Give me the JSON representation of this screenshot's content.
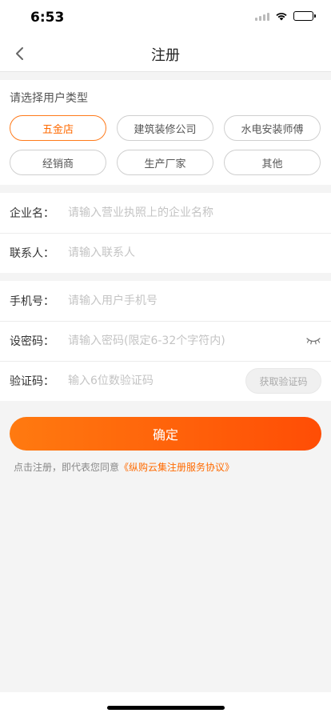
{
  "status_bar": {
    "time": "6:53"
  },
  "nav": {
    "title": "注册"
  },
  "user_type": {
    "label": "请选择用户类型",
    "options": [
      "五金店",
      "建筑装修公司",
      "水电安装师傅",
      "经销商",
      "生产厂家",
      "其他"
    ],
    "selected_index": 0
  },
  "company_form": {
    "company_label": "企业名：",
    "company_placeholder": "请输入营业执照上的企业名称",
    "contact_label": "联系人：",
    "contact_placeholder": "请输入联系人"
  },
  "account_form": {
    "phone_label": "手机号：",
    "phone_placeholder": "请输入用户手机号",
    "password_label": "设密码：",
    "password_placeholder": "请输入密码(限定6-32个字符内)",
    "code_label": "验证码：",
    "code_placeholder": "输入6位数验证码",
    "get_code_label": "获取验证码"
  },
  "submit": {
    "label": "确定"
  },
  "agreement": {
    "prefix": "点击注册，即代表您同意",
    "link": "《纵购云集注册服务协议》"
  },
  "colors": {
    "accent": "#ff6a00",
    "background": "#f4f4f4"
  }
}
